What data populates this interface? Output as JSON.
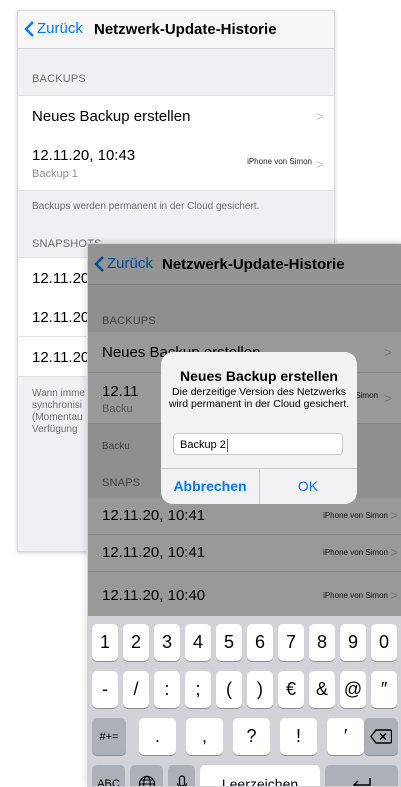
{
  "back_screen": {
    "nav": {
      "back_label": "Zurück",
      "title": "Netzwerk-Update-Historie"
    },
    "backups_header": "BACKUPS",
    "new_backup_label": "Neues Backup erstellen",
    "backup_row": {
      "date": "12.11.20, 10:43",
      "name": "Backup 1",
      "device": "iPhone von Simon"
    },
    "backups_note": "Backups werden permanent in der Cloud gesichert.",
    "snapshots_header": "SNAPSHOTS",
    "snapshot_rows": [
      "12.11.20,",
      "12.11.20,",
      "12.11.20,"
    ],
    "footer_lines": [
      "Wann imme",
      "synchronisi",
      "(Momentau",
      "Verfügung"
    ]
  },
  "front_screen": {
    "nav": {
      "back_label": "Zurück",
      "title": "Netzwerk-Update-Historie"
    },
    "backups_header": "BACKUPS",
    "new_backup_label": "Neues Backup erstellen",
    "backup_row": {
      "date": "12.11",
      "name": "Backu",
      "device": "Simon"
    },
    "note_fragment": "Backu",
    "snapshots_fragment": "SNAPS",
    "snapshot_rows": [
      {
        "date": "12.11.20, 10:41",
        "device": "iPhone von Simon"
      },
      {
        "date": "12.11.20, 10:41",
        "device": "iPhone von Simon"
      },
      {
        "date": "12.11.20, 10:40",
        "device": "iPhone von Simon"
      }
    ],
    "dialog": {
      "title": "Neues Backup erstellen",
      "message_line1": "Die derzeitige Version des Netzwerks",
      "message_line2": "wird permanent in der Cloud gesichert.",
      "input_value": "Backup 2",
      "cancel_label": "Abbrechen",
      "ok_label": "OK"
    },
    "keyboard": {
      "row1": [
        "1",
        "2",
        "3",
        "4",
        "5",
        "6",
        "7",
        "8",
        "9",
        "0"
      ],
      "row2": [
        "-",
        "/",
        ":",
        ";",
        "(",
        ")",
        "€",
        "&",
        "@",
        "″"
      ],
      "row3": [
        ".",
        ",",
        "?",
        "!",
        "′"
      ],
      "mode_key": "#+=",
      "abc_key": "ABC",
      "space_label": "Leerzeichen",
      "delete_icon": "backspace-icon",
      "globe_icon": "globe-icon",
      "mic_icon": "microphone-icon",
      "return_icon": "return-icon"
    }
  }
}
